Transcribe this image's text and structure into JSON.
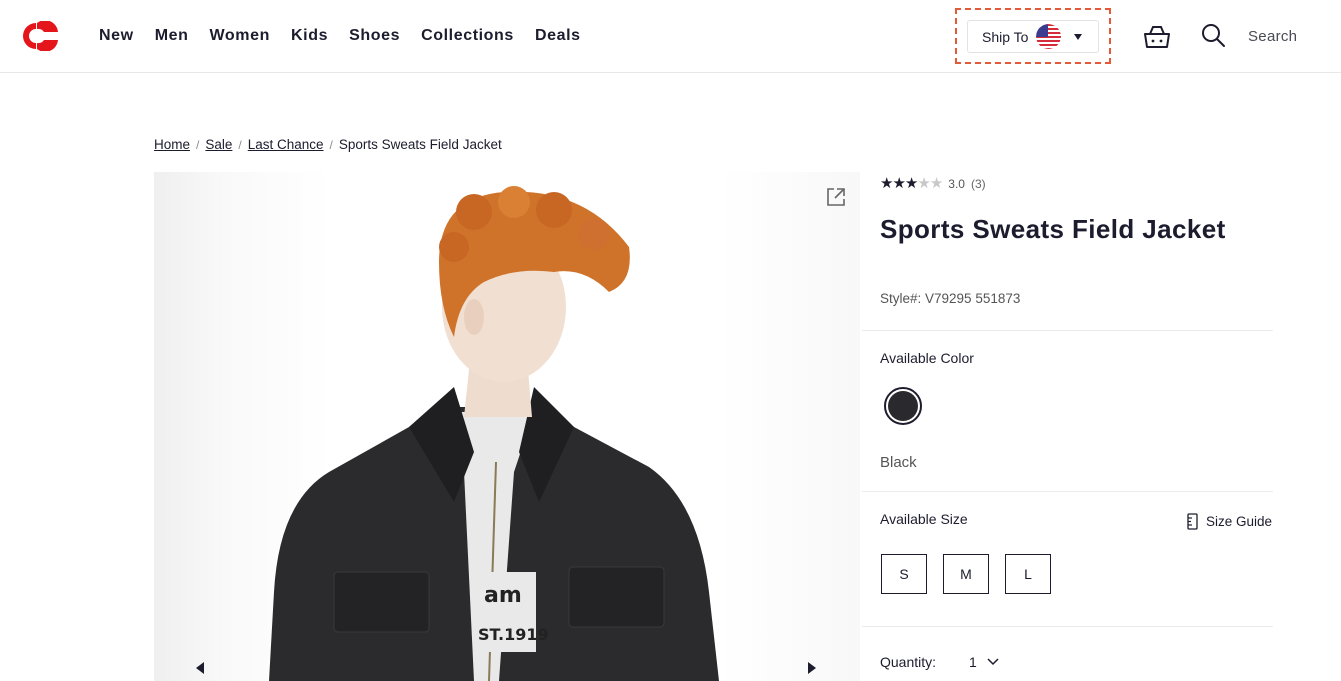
{
  "header": {
    "nav": [
      "New",
      "Men",
      "Women",
      "Kids",
      "Shoes",
      "Collections",
      "Deals"
    ],
    "ship_to_label": "Ship To",
    "search_label": "Search",
    "brand_color": "#e4161c"
  },
  "breadcrumb": {
    "items": [
      "Home",
      "Sale",
      "Last Chance"
    ],
    "separator": "/",
    "current": "Sports Sweats Field Jacket"
  },
  "product": {
    "rating": {
      "value": "3.0",
      "count": "(3)",
      "stars_filled": 3,
      "stars_total": 5
    },
    "title": "Sports Sweats Field Jacket",
    "style": "Style#: V79295  551873",
    "available_color_label": "Available Color",
    "color_name": "Black",
    "swatch_color": "#2a2a2e",
    "available_size_label": "Available Size",
    "size_guide_label": "Size Guide",
    "sizes": [
      "S",
      "M",
      "L"
    ],
    "quantity_label": "Quantity:",
    "quantity_value": "1"
  }
}
